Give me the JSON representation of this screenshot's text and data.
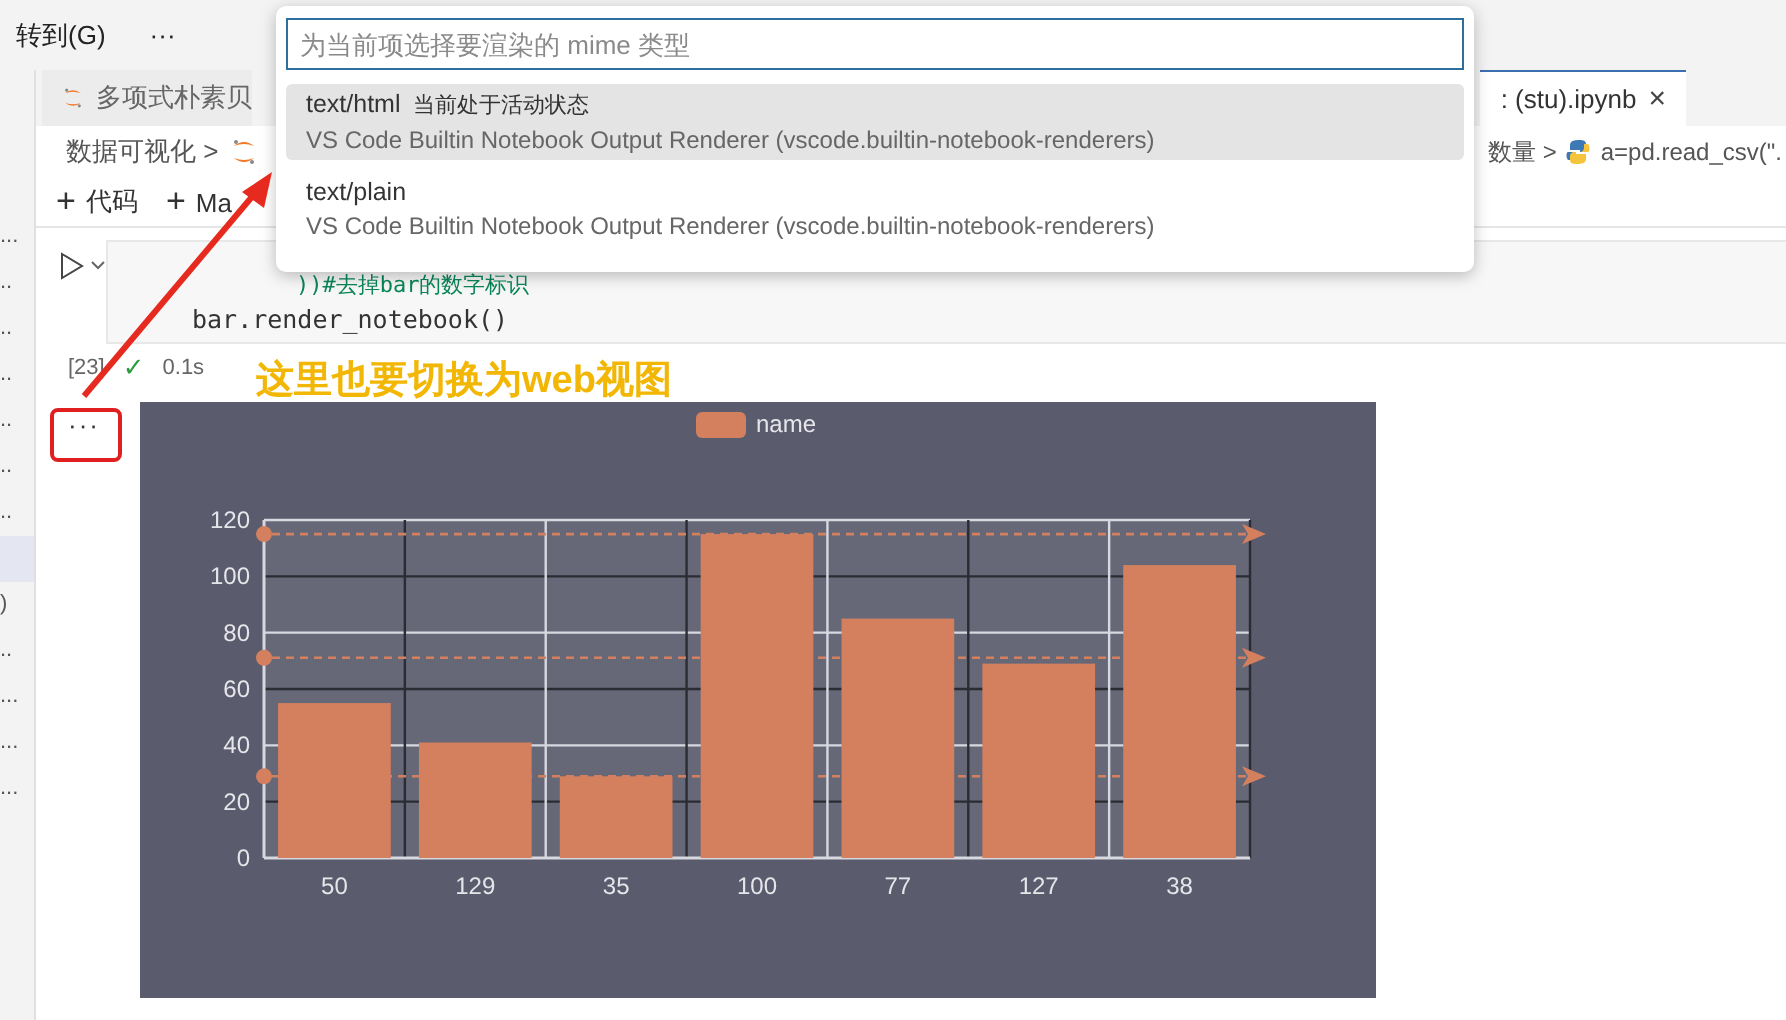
{
  "menu_bar": {
    "items": [
      "转到(G)",
      "···"
    ]
  },
  "sidebar": {
    "items": [
      {
        "label": "...",
        "selected": false
      },
      {
        "label": "..",
        "selected": false
      },
      {
        "label": "..",
        "selected": false
      },
      {
        "label": "..",
        "selected": false
      },
      {
        "label": "..",
        "selected": false
      },
      {
        "label": "..",
        "selected": false
      },
      {
        "label": "..",
        "selected": false
      },
      {
        "selected": true
      },
      {
        "label": ")",
        "selected": false
      },
      {
        "label": "..",
        "selected": false
      },
      {
        "label": "...",
        "selected": false
      },
      {
        "label": "...",
        "selected": false
      },
      {
        "label": "...",
        "selected": false
      }
    ]
  },
  "tabs": [
    {
      "label": "多项式朴素贝",
      "icon": true,
      "selected": false
    },
    {
      "label": ": (stu).ipynb",
      "icon": false,
      "selected": true,
      "close": "×"
    }
  ],
  "breadcrumb": {
    "left": [
      {
        "kind": "text",
        "text": "数据可视化 >"
      },
      {
        "kind": "jupyter"
      }
    ],
    "right": [
      {
        "kind": "text",
        "text": "数量 >"
      },
      {
        "kind": "python"
      },
      {
        "kind": "text",
        "text": "a=pd.read_csv(\"."
      }
    ]
  },
  "toolbar": [
    {
      "icon": "+",
      "label": "代码"
    },
    {
      "icon": "+",
      "label": "Ma"
    }
  ],
  "cell": {
    "code_lines": [
      {
        "kind": "comment",
        "text": "))#去掉bar的数字标识"
      },
      {
        "kind": "code",
        "text": "bar.render_notebook()"
      }
    ],
    "execution_count": "[23]",
    "status": "✓",
    "duration": "0.1s",
    "output_menu": "···"
  },
  "output": {
    "chart_data": {
      "type": "bar",
      "categories": [
        "50",
        "129",
        "35",
        "100",
        "77",
        "127",
        "38"
      ],
      "series": [
        {
          "name": "name",
          "color": "#d4805f",
          "values": [
            55,
            41,
            29,
            115,
            85,
            69,
            104
          ]
        }
      ],
      "ylim": [
        0,
        120
      ],
      "yticks": [
        0,
        20,
        40,
        60,
        80,
        100,
        120
      ],
      "grid": true,
      "ref_lines": [
        {
          "axis": "y",
          "value": 115
        },
        {
          "axis": "y",
          "value": 71.1
        },
        {
          "axis": "y",
          "value": 29
        }
      ]
    }
  },
  "quick_pick": {
    "placeholder": "为当前项选择要渲染的 mime 类型",
    "items": [
      {
        "label": "text/html",
        "badge": "当前处于活动状态",
        "description": "VS Code Builtin Notebook Output Renderer (vscode.builtin-notebook-renderers)",
        "selected": true
      },
      {
        "label": "text/plain",
        "description": "VS Code Builtin Notebook Output Renderer (vscode.builtin-notebook-renderers)",
        "selected": false
      }
    ]
  },
  "annotation": {
    "text": "这里也要切换为web视图"
  }
}
